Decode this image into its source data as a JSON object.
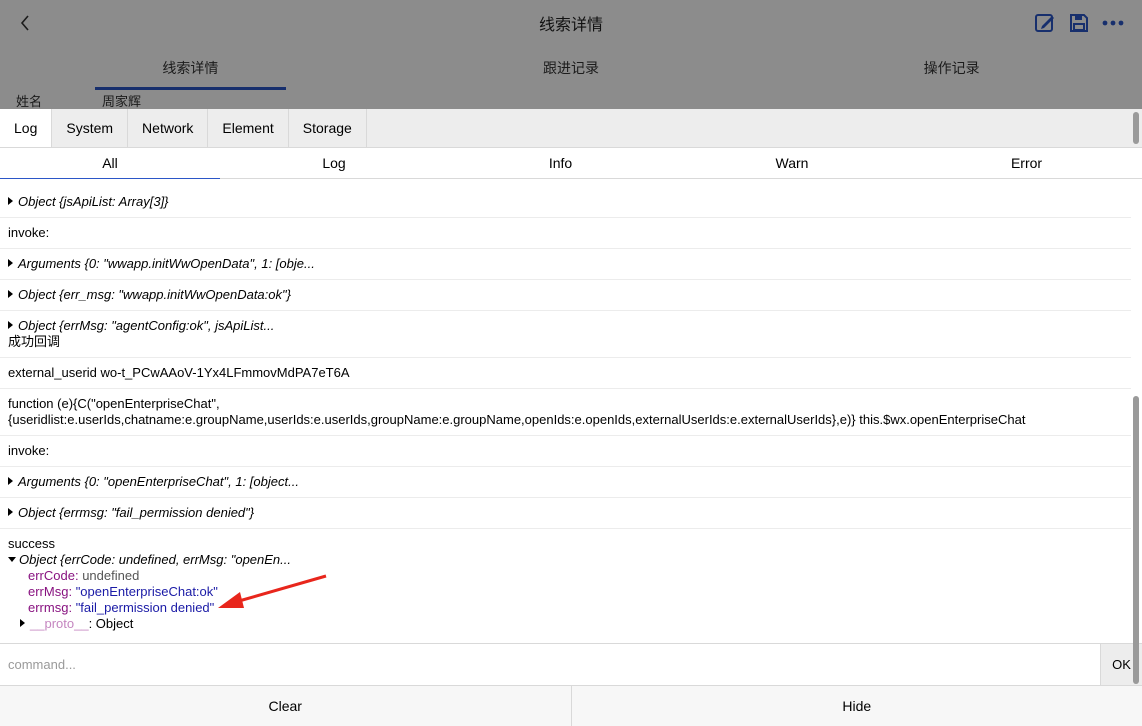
{
  "app": {
    "title": "线索详情",
    "tabs": [
      {
        "label": "线索详情",
        "active": true
      },
      {
        "label": "跟进记录",
        "active": false
      },
      {
        "label": "操作记录",
        "active": false
      }
    ],
    "row": {
      "label": "姓名",
      "value": "周家辉"
    },
    "icons": [
      "back-arrow-icon",
      "edit-icon",
      "save-icon",
      "more-icon"
    ],
    "accent": "#2b56c7"
  },
  "vconsole": {
    "tabs": [
      "Log",
      "System",
      "Network",
      "Element",
      "Storage"
    ],
    "active_tab": "Log",
    "subtabs": [
      "All",
      "Log",
      "Info",
      "Warn",
      "Error"
    ],
    "active_subtab": "All",
    "logs": [
      {
        "text": "Object {jsApiList: Array[3]}"
      },
      {
        "text": "invoke:"
      },
      {
        "text": "Arguments {0: \"wwapp.initWwOpenData\", 1: [obje..."
      },
      {
        "text": "Object {err_msg: \"wwapp.initWwOpenData:ok\"}"
      },
      {
        "text": "Object {errMsg: \"agentConfig:ok\", jsApiList...",
        "text2": "成功回调"
      },
      {
        "text": "external_userid wo-t_PCwAAoV-1Yx4LFmmovMdPA7eT6A"
      },
      {
        "text": "function (e){C(\"openEnterpriseChat\",",
        "text2": "{useridlist:e.userIds,chatname:e.groupName,userIds:e.userIds,groupName:e.groupName,openIds:e.openIds,externalUserIds:e.externalUserIds},e)} this.$wx.openEnterpriseChat"
      },
      {
        "text": "invoke:"
      },
      {
        "text": "Arguments {0: \"openEnterpriseChat\", 1: [object..."
      },
      {
        "text": "Object {errmsg: \"fail_permission denied\"}"
      },
      {
        "text": "success",
        "expanded": "Object {errCode: undefined, errMsg: \"openEn...",
        "props": [
          {
            "key": "errCode",
            "value": "undefined"
          },
          {
            "key": "errMsg",
            "value": "\"openEnterpriseChat:ok\""
          },
          {
            "key": "errmsg",
            "value": "\"fail_permission denied\""
          }
        ],
        "proto_key": "__proto__",
        "proto_value": "Object"
      }
    ],
    "command_placeholder": "command...",
    "ok_label": "OK",
    "clear_label": "Clear",
    "hide_label": "Hide"
  },
  "annotation_color": "#e8261c"
}
